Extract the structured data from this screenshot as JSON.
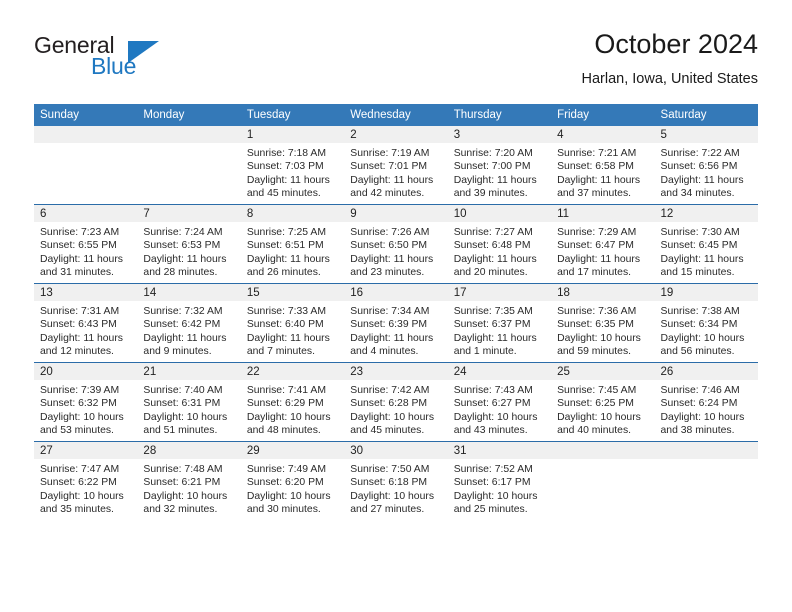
{
  "brand": {
    "name_top": "General",
    "name_bottom": "Blue",
    "accent_color": "#1f78c1",
    "triangle_icon": "triangle-icon"
  },
  "header": {
    "title": "October 2024",
    "location": "Harlan, Iowa, United States"
  },
  "theme": {
    "header_blue": "#3479b8",
    "row_divider_blue": "#2b6ca8",
    "daynum_band_gray": "#f0f0f0",
    "text_color": "#2a2a2a"
  },
  "weekday_headers": [
    "Sunday",
    "Monday",
    "Tuesday",
    "Wednesday",
    "Thursday",
    "Friday",
    "Saturday"
  ],
  "weeks": [
    [
      {
        "day": "",
        "empty": true,
        "sunrise": "",
        "sunset": "",
        "daylight_line1": "",
        "daylight_line2": ""
      },
      {
        "day": "",
        "empty": true,
        "sunrise": "",
        "sunset": "",
        "daylight_line1": "",
        "daylight_line2": ""
      },
      {
        "day": "1",
        "sunrise": "Sunrise: 7:18 AM",
        "sunset": "Sunset: 7:03 PM",
        "daylight_line1": "Daylight: 11 hours",
        "daylight_line2": "and 45 minutes."
      },
      {
        "day": "2",
        "sunrise": "Sunrise: 7:19 AM",
        "sunset": "Sunset: 7:01 PM",
        "daylight_line1": "Daylight: 11 hours",
        "daylight_line2": "and 42 minutes."
      },
      {
        "day": "3",
        "sunrise": "Sunrise: 7:20 AM",
        "sunset": "Sunset: 7:00 PM",
        "daylight_line1": "Daylight: 11 hours",
        "daylight_line2": "and 39 minutes."
      },
      {
        "day": "4",
        "sunrise": "Sunrise: 7:21 AM",
        "sunset": "Sunset: 6:58 PM",
        "daylight_line1": "Daylight: 11 hours",
        "daylight_line2": "and 37 minutes."
      },
      {
        "day": "5",
        "sunrise": "Sunrise: 7:22 AM",
        "sunset": "Sunset: 6:56 PM",
        "daylight_line1": "Daylight: 11 hours",
        "daylight_line2": "and 34 minutes."
      }
    ],
    [
      {
        "day": "6",
        "sunrise": "Sunrise: 7:23 AM",
        "sunset": "Sunset: 6:55 PM",
        "daylight_line1": "Daylight: 11 hours",
        "daylight_line2": "and 31 minutes."
      },
      {
        "day": "7",
        "sunrise": "Sunrise: 7:24 AM",
        "sunset": "Sunset: 6:53 PM",
        "daylight_line1": "Daylight: 11 hours",
        "daylight_line2": "and 28 minutes."
      },
      {
        "day": "8",
        "sunrise": "Sunrise: 7:25 AM",
        "sunset": "Sunset: 6:51 PM",
        "daylight_line1": "Daylight: 11 hours",
        "daylight_line2": "and 26 minutes."
      },
      {
        "day": "9",
        "sunrise": "Sunrise: 7:26 AM",
        "sunset": "Sunset: 6:50 PM",
        "daylight_line1": "Daylight: 11 hours",
        "daylight_line2": "and 23 minutes."
      },
      {
        "day": "10",
        "sunrise": "Sunrise: 7:27 AM",
        "sunset": "Sunset: 6:48 PM",
        "daylight_line1": "Daylight: 11 hours",
        "daylight_line2": "and 20 minutes."
      },
      {
        "day": "11",
        "sunrise": "Sunrise: 7:29 AM",
        "sunset": "Sunset: 6:47 PM",
        "daylight_line1": "Daylight: 11 hours",
        "daylight_line2": "and 17 minutes."
      },
      {
        "day": "12",
        "sunrise": "Sunrise: 7:30 AM",
        "sunset": "Sunset: 6:45 PM",
        "daylight_line1": "Daylight: 11 hours",
        "daylight_line2": "and 15 minutes."
      }
    ],
    [
      {
        "day": "13",
        "sunrise": "Sunrise: 7:31 AM",
        "sunset": "Sunset: 6:43 PM",
        "daylight_line1": "Daylight: 11 hours",
        "daylight_line2": "and 12 minutes."
      },
      {
        "day": "14",
        "sunrise": "Sunrise: 7:32 AM",
        "sunset": "Sunset: 6:42 PM",
        "daylight_line1": "Daylight: 11 hours",
        "daylight_line2": "and 9 minutes."
      },
      {
        "day": "15",
        "sunrise": "Sunrise: 7:33 AM",
        "sunset": "Sunset: 6:40 PM",
        "daylight_line1": "Daylight: 11 hours",
        "daylight_line2": "and 7 minutes."
      },
      {
        "day": "16",
        "sunrise": "Sunrise: 7:34 AM",
        "sunset": "Sunset: 6:39 PM",
        "daylight_line1": "Daylight: 11 hours",
        "daylight_line2": "and 4 minutes."
      },
      {
        "day": "17",
        "sunrise": "Sunrise: 7:35 AM",
        "sunset": "Sunset: 6:37 PM",
        "daylight_line1": "Daylight: 11 hours",
        "daylight_line2": "and 1 minute."
      },
      {
        "day": "18",
        "sunrise": "Sunrise: 7:36 AM",
        "sunset": "Sunset: 6:35 PM",
        "daylight_line1": "Daylight: 10 hours",
        "daylight_line2": "and 59 minutes."
      },
      {
        "day": "19",
        "sunrise": "Sunrise: 7:38 AM",
        "sunset": "Sunset: 6:34 PM",
        "daylight_line1": "Daylight: 10 hours",
        "daylight_line2": "and 56 minutes."
      }
    ],
    [
      {
        "day": "20",
        "sunrise": "Sunrise: 7:39 AM",
        "sunset": "Sunset: 6:32 PM",
        "daylight_line1": "Daylight: 10 hours",
        "daylight_line2": "and 53 minutes."
      },
      {
        "day": "21",
        "sunrise": "Sunrise: 7:40 AM",
        "sunset": "Sunset: 6:31 PM",
        "daylight_line1": "Daylight: 10 hours",
        "daylight_line2": "and 51 minutes."
      },
      {
        "day": "22",
        "sunrise": "Sunrise: 7:41 AM",
        "sunset": "Sunset: 6:29 PM",
        "daylight_line1": "Daylight: 10 hours",
        "daylight_line2": "and 48 minutes."
      },
      {
        "day": "23",
        "sunrise": "Sunrise: 7:42 AM",
        "sunset": "Sunset: 6:28 PM",
        "daylight_line1": "Daylight: 10 hours",
        "daylight_line2": "and 45 minutes."
      },
      {
        "day": "24",
        "sunrise": "Sunrise: 7:43 AM",
        "sunset": "Sunset: 6:27 PM",
        "daylight_line1": "Daylight: 10 hours",
        "daylight_line2": "and 43 minutes."
      },
      {
        "day": "25",
        "sunrise": "Sunrise: 7:45 AM",
        "sunset": "Sunset: 6:25 PM",
        "daylight_line1": "Daylight: 10 hours",
        "daylight_line2": "and 40 minutes."
      },
      {
        "day": "26",
        "sunrise": "Sunrise: 7:46 AM",
        "sunset": "Sunset: 6:24 PM",
        "daylight_line1": "Daylight: 10 hours",
        "daylight_line2": "and 38 minutes."
      }
    ],
    [
      {
        "day": "27",
        "sunrise": "Sunrise: 7:47 AM",
        "sunset": "Sunset: 6:22 PM",
        "daylight_line1": "Daylight: 10 hours",
        "daylight_line2": "and 35 minutes."
      },
      {
        "day": "28",
        "sunrise": "Sunrise: 7:48 AM",
        "sunset": "Sunset: 6:21 PM",
        "daylight_line1": "Daylight: 10 hours",
        "daylight_line2": "and 32 minutes."
      },
      {
        "day": "29",
        "sunrise": "Sunrise: 7:49 AM",
        "sunset": "Sunset: 6:20 PM",
        "daylight_line1": "Daylight: 10 hours",
        "daylight_line2": "and 30 minutes."
      },
      {
        "day": "30",
        "sunrise": "Sunrise: 7:50 AM",
        "sunset": "Sunset: 6:18 PM",
        "daylight_line1": "Daylight: 10 hours",
        "daylight_line2": "and 27 minutes."
      },
      {
        "day": "31",
        "sunrise": "Sunrise: 7:52 AM",
        "sunset": "Sunset: 6:17 PM",
        "daylight_line1": "Daylight: 10 hours",
        "daylight_line2": "and 25 minutes."
      },
      {
        "day": "",
        "empty": true,
        "sunrise": "",
        "sunset": "",
        "daylight_line1": "",
        "daylight_line2": ""
      },
      {
        "day": "",
        "empty": true,
        "sunrise": "",
        "sunset": "",
        "daylight_line1": "",
        "daylight_line2": ""
      }
    ]
  ]
}
